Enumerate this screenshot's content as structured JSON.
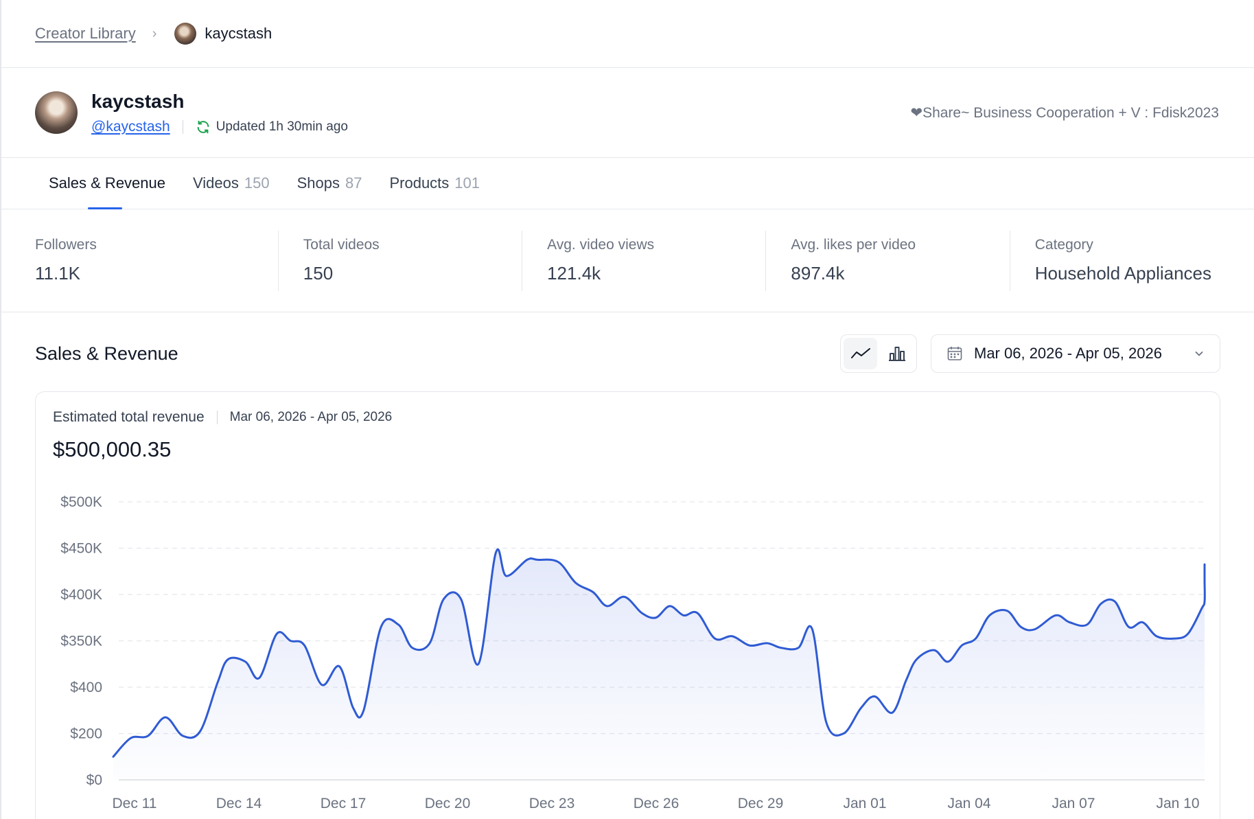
{
  "breadcrumb": {
    "parent": "Creator Library",
    "current": "kaycstash"
  },
  "profile": {
    "name": "kaycstash",
    "handle": "@kaycstash",
    "updated": "Updated 1h 30min ago",
    "bio": "❤Share~ Business Cooperation + V : Fdisk2023"
  },
  "tabs": [
    {
      "label": "Sales & Revenue",
      "count": ""
    },
    {
      "label": "Videos",
      "count": "150"
    },
    {
      "label": "Shops",
      "count": "87"
    },
    {
      "label": "Products",
      "count": "101"
    }
  ],
  "stats": [
    {
      "label": "Followers",
      "value": "11.1K"
    },
    {
      "label": "Total videos",
      "value": "150"
    },
    {
      "label": "Avg. video views",
      "value": "121.4k"
    },
    {
      "label": "Avg. likes per video",
      "value": "897.4k"
    },
    {
      "label": "Category",
      "value": "Household Appliances"
    }
  ],
  "section": {
    "title": "Sales & Revenue",
    "date_range": "Mar 06, 2026 - Apr 05, 2026"
  },
  "card": {
    "label": "Estimated total revenue",
    "range": "Mar 06, 2026 - Apr 05, 2026",
    "value": "$500,000.35"
  },
  "colors": {
    "accent": "#2563eb",
    "line": "#2f5bd3",
    "grid": "#e5e7eb"
  },
  "chart_data": {
    "type": "area",
    "y_tick_labels": [
      "$0",
      "$200",
      "$400",
      "$350K",
      "$400K",
      "$450K",
      "$500K"
    ],
    "x_tick_labels": [
      "Dec 11",
      "Dec 14",
      "Dec 17",
      "Dec 20",
      "Dec 23",
      "Dec 26",
      "Dec 29",
      "Jan 01",
      "Jan 04",
      "Jan 07",
      "Jan 10"
    ],
    "grid": "dashed horizontal",
    "series": [
      {
        "x": [
          0,
          0.5,
          1,
          1.5,
          2,
          2.5,
          3,
          3.3,
          3.8,
          4.2,
          4.7,
          5.1,
          5.5,
          6,
          6.5,
          6.9,
          7.2,
          7.7,
          8.2,
          8.6,
          9.1,
          9.5,
          10,
          10.5,
          11,
          11.3,
          11.9,
          12.2,
          12.8,
          13.3,
          13.8,
          14.2,
          14.7,
          15.2,
          15.6,
          16,
          16.4,
          16.8,
          17.3,
          17.8,
          18.3,
          18.8,
          19.2,
          19.7,
          20.1,
          20.5,
          21,
          21.5,
          21.9,
          22.4,
          22.8,
          23.1,
          23.6,
          24,
          24.4,
          24.8,
          25.2,
          25.7,
          26.1,
          26.5,
          27.1,
          27.5,
          28,
          28.4,
          28.8,
          29.2,
          29.6,
          30,
          30.5,
          30.9,
          31.3,
          31.6,
          32,
          32.4
        ],
        "values": [
          0.5,
          0.9,
          0.95,
          1.35,
          0.95,
          1.05,
          2.1,
          2.6,
          2.55,
          2.2,
          3.15,
          3.0,
          2.9,
          2.05,
          2.45,
          1.55,
          1.5,
          3.3,
          3.35,
          2.85,
          2.95,
          3.9,
          3.9,
          2.5,
          4.9,
          4.4,
          4.75,
          4.75,
          4.7,
          4.25,
          4.05,
          3.75,
          3.95,
          3.6,
          3.5,
          3.75,
          3.55,
          3.6,
          3.05,
          3.1,
          2.9,
          2.95,
          2.85,
          2.85,
          3.25,
          1.25,
          1.0,
          1.55,
          1.8,
          1.45,
          2.15,
          2.6,
          2.8,
          2.55,
          2.9,
          3.05,
          3.55,
          3.65,
          3.3,
          3.25,
          3.55,
          3.4,
          3.35,
          3.8,
          3.85,
          3.3,
          3.4,
          3.1,
          3.05,
          3.15,
          3.7,
          3.85,
          4.3,
          4.65
        ]
      }
    ]
  }
}
